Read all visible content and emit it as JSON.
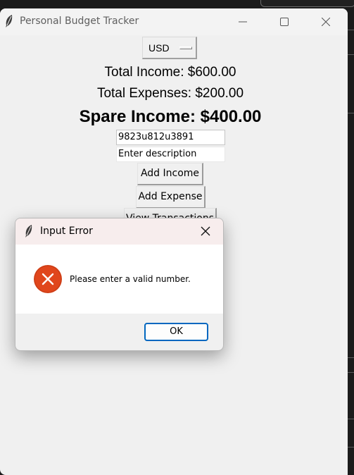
{
  "window": {
    "title": "Personal Budget Tracker",
    "icon": "feather-icon",
    "controls": [
      "minimize-icon",
      "maximize-icon",
      "close-icon"
    ]
  },
  "currency": {
    "selected": "USD"
  },
  "summary": {
    "total_income": "Total Income: $600.00",
    "total_expenses": "Total Expenses: $200.00",
    "spare_income": "Spare Income: $400.00"
  },
  "inputs": {
    "amount_value": "9823u812u3891",
    "description_value": "Enter description"
  },
  "buttons": {
    "add_income": "Add Income",
    "add_expense": "Add Expense",
    "view_transactions": "View Transactions"
  },
  "dialog": {
    "title": "Input Error",
    "message": "Please enter a valid number.",
    "ok_label": "OK",
    "icon": "error-icon"
  },
  "colors": {
    "error_icon": "#e0461c",
    "ok_border": "#0067c0",
    "window_bg": "#f0f0f0"
  }
}
